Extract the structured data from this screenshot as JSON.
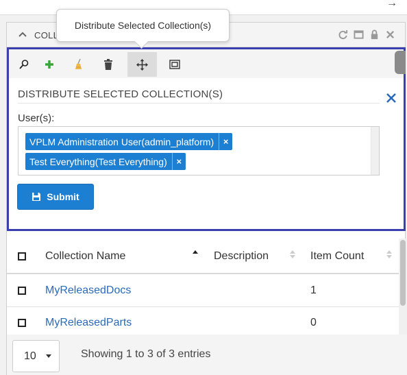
{
  "widget": {
    "title": "COLL",
    "tooltip": "Distribute Selected Collection(s)"
  },
  "toolbar": {
    "buttons": [
      {
        "name": "search-icon"
      },
      {
        "name": "add-icon"
      },
      {
        "name": "clear-icon"
      },
      {
        "name": "delete-icon"
      },
      {
        "name": "move-icon"
      },
      {
        "name": "fit-icon"
      }
    ]
  },
  "form": {
    "title": "DISTRIBUTE SELECTED COLLECTION(S)",
    "users_label": "User(s):",
    "selected_users": [
      "VPLM Administration User(admin_platform)",
      "Test Everything(Test Everything)"
    ],
    "tag_remove": "×",
    "submit_label": "Submit"
  },
  "table": {
    "headers": {
      "name": "Collection Name",
      "description": "Description",
      "item_count": "Item Count"
    },
    "rows": [
      {
        "name": "MyReleasedDocs",
        "description": "",
        "item_count": "1"
      },
      {
        "name": "MyReleasedParts",
        "description": "",
        "item_count": "0"
      }
    ]
  },
  "footer": {
    "page_size": "10",
    "showing": "Showing 1 to 3 of 3 entries"
  },
  "colors": {
    "accent": "#1d7fd1",
    "focus_border": "#3a3fb0",
    "link": "#2a6ab8",
    "add_green": "#3aa53a"
  }
}
